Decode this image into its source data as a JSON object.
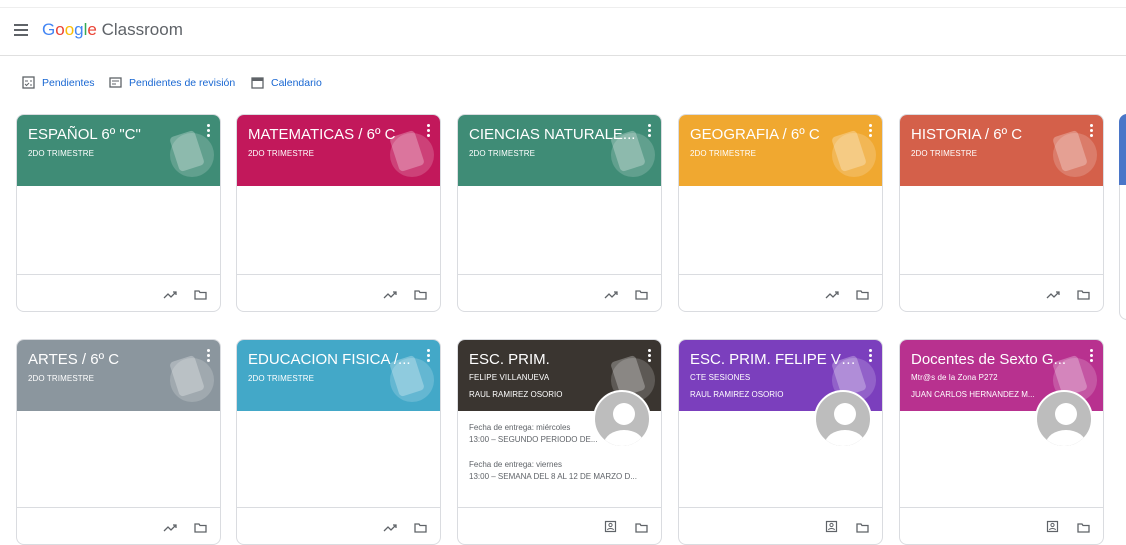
{
  "app": {
    "brand_google": "Google",
    "brand_product": "Classroom"
  },
  "subnav": [
    {
      "label": "Pendientes",
      "icon": "todo-icon"
    },
    {
      "label": "Pendientes de revisión",
      "icon": "review-icon"
    },
    {
      "label": "Calendario",
      "icon": "calendar-icon"
    }
  ],
  "cards": [
    {
      "title": "ESPAÑOL 6º \"C\"",
      "section": "2DO TRIMESTRE",
      "color": "#3f8c76"
    },
    {
      "title": "MATEMATICAS / 6º C",
      "section": "2DO TRIMESTRE",
      "color": "#c2185b"
    },
    {
      "title": "CIENCIAS NATURALE...",
      "section": "2DO TRIMESTRE",
      "color": "#3f8c76"
    },
    {
      "title": "GEOGRAFIA / 6º C",
      "section": "2DO TRIMESTRE",
      "color": "#f0a830"
    },
    {
      "title": "HISTORIA / 6º C",
      "section": "2DO TRIMESTRE",
      "color": "#d4604a"
    },
    {
      "title": "ARTES / 6º C",
      "section": "2DO TRIMESTRE",
      "color": "#8b969e"
    },
    {
      "title": "EDUCACION FISICA /...",
      "section": "2DO TRIMESTRE",
      "color": "#43a8c8"
    },
    {
      "title": "ESC. PRIM.",
      "section": "FELIPE VILLANUEVA",
      "teacher": "RAUL RAMIREZ OSORIO",
      "color": "#3a3530",
      "due": [
        {
          "label": "Fecha de entrega: miércoles",
          "item": "13:00 – SEGUNDO PERIODO DE..."
        },
        {
          "label": "Fecha de entrega: viernes",
          "item": "13:00 – SEMANA DEL 8 AL 12 DE MARZO D..."
        }
      ]
    },
    {
      "title": "ESC. PRIM. FELIPE VIL...",
      "section": "CTE SESIONES",
      "teacher": "RAUL RAMIREZ OSORIO",
      "color": "#7b3fbd"
    },
    {
      "title": "Docentes de Sexto G...",
      "section": "Mtr@s de la Zona P272",
      "teacher": "JUAN CARLOS HERNANDEZ M...",
      "color": "#b8318f"
    }
  ]
}
